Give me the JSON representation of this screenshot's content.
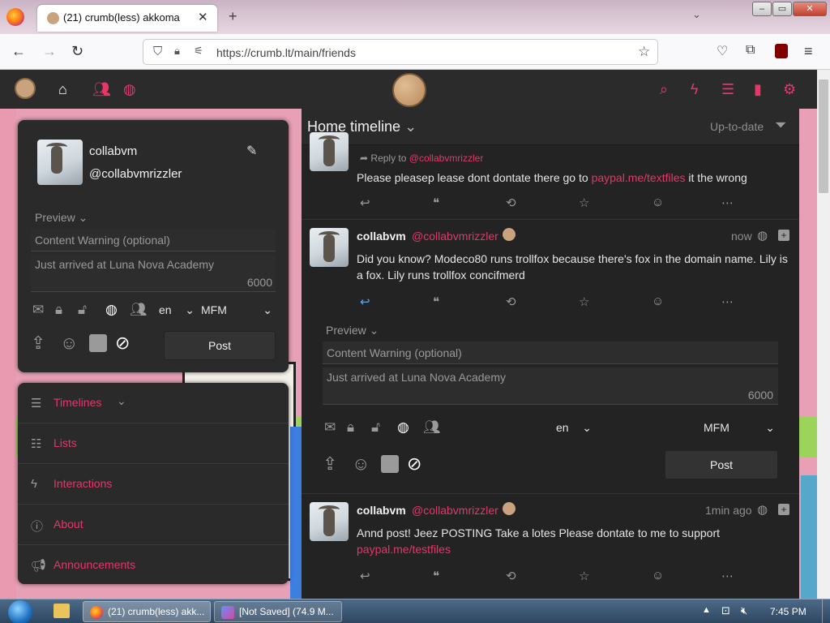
{
  "browser": {
    "tab_title": "(21) crumb(less) akkoma",
    "url": "https://crumb.lt/main/friends"
  },
  "timeline": {
    "title": "Home timeline",
    "filter": "Up-to-date"
  },
  "posts": [
    {
      "reply_to_label": "Reply to",
      "reply_to_handle": "@collabvmrizzler",
      "text": "Please pleasep lease dont dontate there go to",
      "link": "paypal.me/textfiles",
      "text_after": "it the wrong"
    },
    {
      "name": "collabvm",
      "handle": "@collabvmrizzler",
      "time": "now",
      "text": "Did you know? Modeco80 runs trollfox because there's fox in the domain name. Lily is a fox. Lily runs trollfox concifmerd"
    },
    {
      "name": "collabvm",
      "handle": "@collabvmrizzler",
      "time": "1min ago",
      "text": "Annd post! Jeez  POSTING Take a lotes Please dontate to me to support",
      "link": "paypal.me/testfiles"
    }
  ],
  "composer": {
    "preview": "Preview",
    "cw_placeholder": "Content Warning (optional)",
    "text": "Just arrived at Luna Nova Academy",
    "counter": "6000",
    "lang": "en",
    "format": "MFM",
    "post_button": "Post"
  },
  "profile": {
    "name": "collabvm",
    "handle": "@collabvmrizzler"
  },
  "menu": [
    {
      "label": "Timelines",
      "icon": "menu-icon"
    },
    {
      "label": "Lists",
      "icon": "list-icon"
    },
    {
      "label": "Interactions",
      "icon": "bolt-icon"
    },
    {
      "label": "About",
      "icon": "info-icon"
    },
    {
      "label": "Announcements",
      "icon": "megaphone-icon"
    }
  ],
  "taskbar": {
    "firefox_task": "(21) crumb(less) akk...",
    "other_task": "[Not Saved]  (74.9 M...",
    "clock": "7:45 PM"
  },
  "colors": {
    "accent": "#e6366a",
    "panel": "#2a2a2a",
    "timeline_bg": "#232323"
  }
}
